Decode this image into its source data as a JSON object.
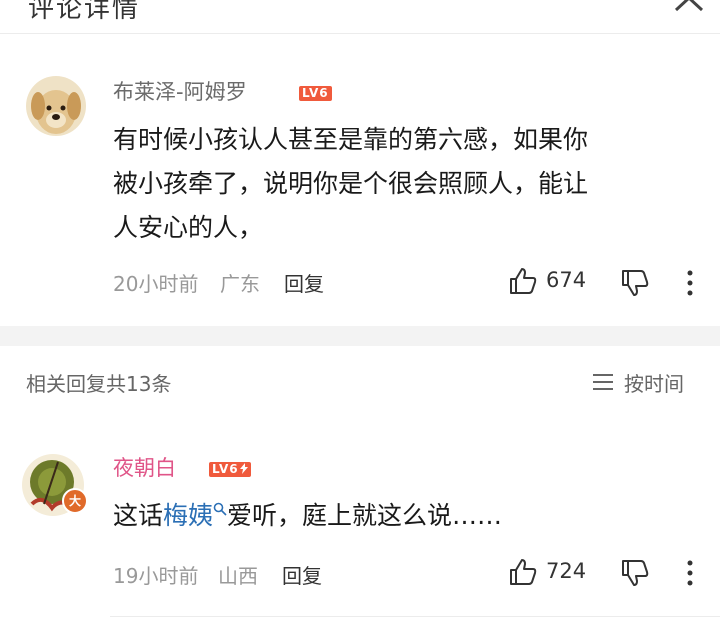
{
  "header": {
    "title": "评论详情"
  },
  "main_comment": {
    "username": "布莱泽-阿姆罗",
    "level": "LV6",
    "text_lines": [
      "有时候小孩认人甚至是靠的第六感，如果你",
      "被小孩牵了，说明你是个很会照顾人，能让",
      "人安心的人，"
    ],
    "time": "20小时前",
    "location": "广东",
    "reply_label": "回复",
    "like_count": "674"
  },
  "replies_section": {
    "title": "相关回复共13条",
    "sort_label": "按时间"
  },
  "reply": {
    "username": "夜朝白",
    "level": "LV6",
    "badge_char": "大",
    "text_before": "这话",
    "link_text": "梅姨",
    "text_after": "爱听，庭上就这么说……",
    "time": "19小时前",
    "location": "山西",
    "reply_label": "回复",
    "like_count": "724"
  },
  "colors": {
    "level_badge": "#f05a3c",
    "reply_username": "#e05588",
    "link": "#2b6fb5",
    "meta_gray": "#999999"
  },
  "icons": [
    "close-icon",
    "thumbs-up-icon",
    "thumbs-down-icon",
    "more-icon",
    "sort-icon",
    "search-icon",
    "lightning-icon"
  ]
}
